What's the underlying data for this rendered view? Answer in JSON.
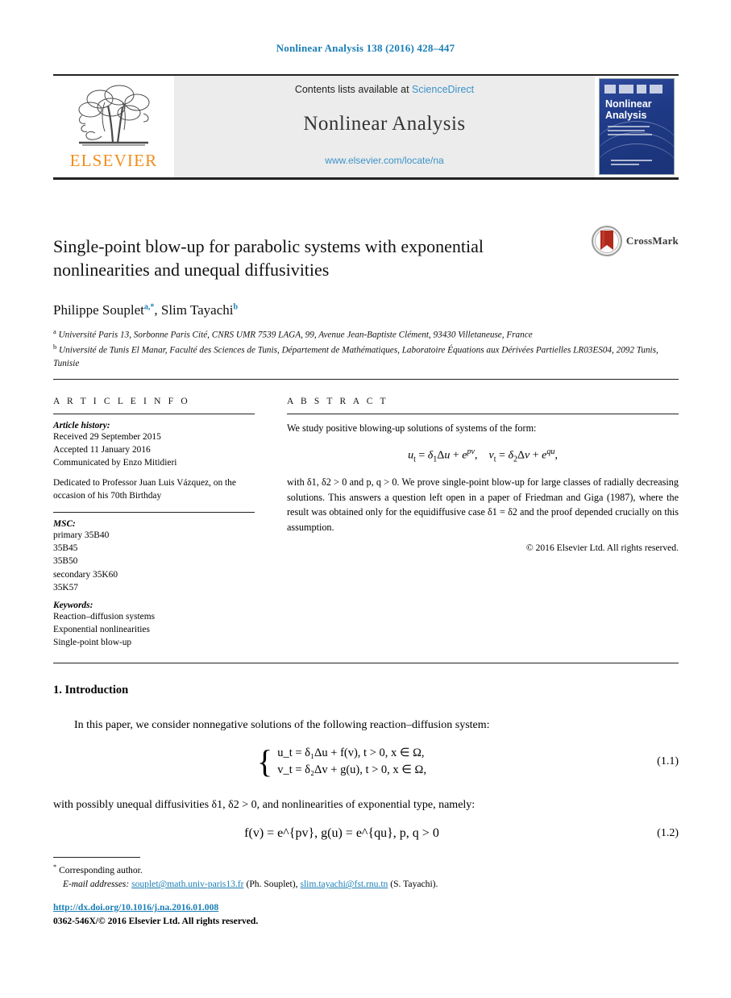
{
  "running_head": "Nonlinear Analysis 138 (2016) 428–447",
  "masthead": {
    "contents_prefix": "Contents lists available at ",
    "sciencedirect": "ScienceDirect",
    "journal_name": "Nonlinear Analysis",
    "journal_url": "www.elsevier.com/locate/na",
    "publisher_wordmark": "ELSEVIER",
    "cover_title_line1": "Nonlinear",
    "cover_title_line2": "Analysis",
    "accent_blue": "#3b93c7",
    "elsevier_orange": "#f08d1c",
    "cover_blue": "#24409a"
  },
  "article": {
    "title": "Single-point blow-up for parabolic systems with exponential nonlinearities and unequal diffusivities",
    "crossmark_label": "CrossMark",
    "authors": [
      {
        "name": "Philippe Souplet",
        "marks": "a,*"
      },
      {
        "name": "Slim Tayachi",
        "marks": "b"
      }
    ],
    "authors_separator": ", ",
    "affiliations": [
      {
        "mark": "a",
        "text": "Université Paris 13, Sorbonne Paris Cité, CNRS UMR 7539 LAGA, 99, Avenue Jean-Baptiste Clément, 93430 Villetaneuse, France"
      },
      {
        "mark": "b",
        "text": "Université de Tunis El Manar, Faculté des Sciences de Tunis, Département de Mathématiques, Laboratoire Équations aux Dérivées Partielles LR03ES04, 2092 Tunis, Tunisie"
      }
    ]
  },
  "info": {
    "heading": "A R T I C L E    I N F O",
    "history_label": "Article history:",
    "received": "Received 29 September 2015",
    "accepted": "Accepted 11 January 2016",
    "communicated": "Communicated by Enzo Mitidieri",
    "dedication": "Dedicated to Professor Juan Luis Vázquez, on the occasion of his 70th Birthday",
    "msc_label": "MSC:",
    "msc": [
      "primary 35B40",
      "35B45",
      "35B50",
      "secondary 35K60",
      "35K57"
    ],
    "keywords_label": "Keywords:",
    "keywords": [
      "Reaction–diffusion systems",
      "Exponential nonlinearities",
      "Single-point blow-up"
    ]
  },
  "abstract": {
    "heading": "A B S T R A C T",
    "intro": "We study positive blowing-up solutions of systems of the form:",
    "equation": {
      "lhs1": "u",
      "lhs1_sub": "t",
      "eq1": " = ",
      "delta1": "δ",
      "delta1_sub": "1",
      "lap": "Δ",
      "u": "u",
      "plus": " + ",
      "exp1_base": "e",
      "exp1_sup": "pv",
      "comma": ",",
      "lhs2": "v",
      "lhs2_sub": "t",
      "delta2": "δ",
      "delta2_sub": "2",
      "v": "v",
      "exp2_base": "e",
      "exp2_sup": "qu"
    },
    "body": "with δ1, δ2 > 0 and p, q > 0. We prove single-point blow-up for large classes of radially decreasing solutions. This answers a question left open in a paper of Friedman and Giga (1987), where the result was obtained only for the equidiffusive case δ1 = δ2 and the proof depended crucially on this assumption.",
    "copyright": "© 2016 Elsevier Ltd. All rights reserved."
  },
  "body_section": {
    "heading": "1.  Introduction",
    "para1": "In this paper, we consider nonnegative solutions of the following reaction–diffusion system:",
    "eq11": {
      "row1": "u_t = δ₁Δu + f(v),   t > 0,  x ∈ Ω,",
      "row2": "v_t = δ₂Δv + g(u),   t > 0,  x ∈ Ω,",
      "number": "(1.1)"
    },
    "para2": "with possibly unequal diffusivities δ1, δ2 > 0, and nonlinearities of exponential type, namely:",
    "eq12": {
      "text": "f(v) = e^{pv},   g(u) = e^{qu},   p, q > 0",
      "number": "(1.2)"
    }
  },
  "footnotes": {
    "corresponding_mark": "*",
    "corresponding": "Corresponding author.",
    "email_label": "E-mail addresses:",
    "email1": "souplet@math.univ-paris13.fr",
    "email1_owner": "(Ph. Souplet),",
    "email2": "slim.tayachi@fst.rnu.tn",
    "email2_owner": "(S. Tayachi)."
  },
  "footer": {
    "doi": "http://dx.doi.org/10.1016/j.na.2016.01.008",
    "issn_line": "0362-546X/© 2016 Elsevier Ltd. All rights reserved."
  }
}
